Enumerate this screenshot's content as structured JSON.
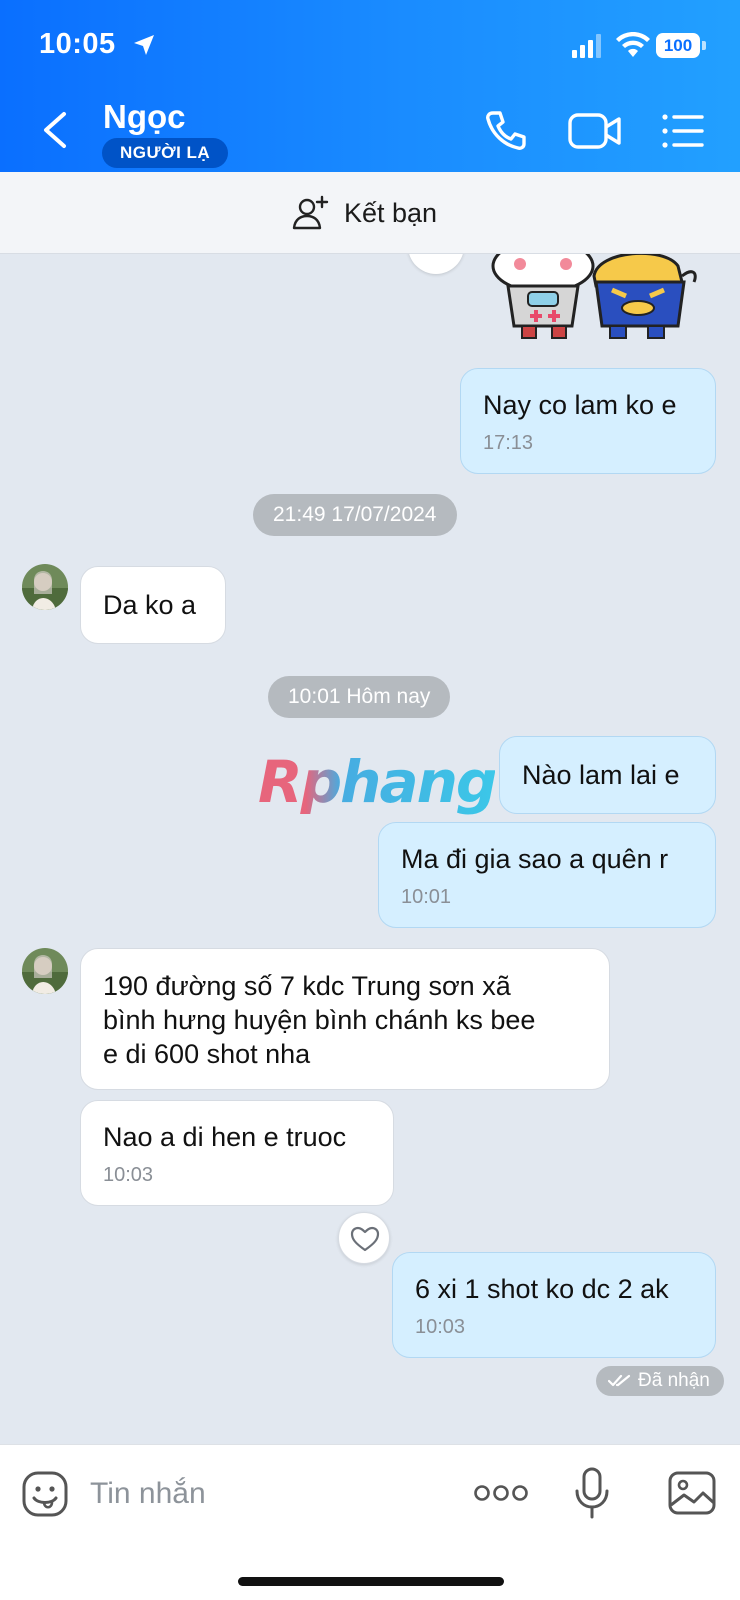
{
  "status_bar": {
    "time": "10:05",
    "battery": "100"
  },
  "header": {
    "contact_name": "Ngọc",
    "badge": "NGƯỜI LẠ"
  },
  "add_friend": {
    "label": "Kết bạn"
  },
  "messages": [
    {
      "side": "out",
      "text": "Nay co lam ko e",
      "time": "17:13"
    },
    {
      "type": "date",
      "text": "21:49 17/07/2024"
    },
    {
      "side": "in",
      "text": "Da ko a"
    },
    {
      "type": "date",
      "text": "10:01 Hôm nay"
    },
    {
      "side": "out",
      "text": "Nào lam lai e"
    },
    {
      "side": "out",
      "text": "Ma đi gia sao a quên r",
      "time": "10:01"
    },
    {
      "side": "in",
      "lines": [
        "190 đường số 7 kdc Trung sơn xã",
        "bình hưng huyện bình chánh ks bee",
        "e di 600 shot nha"
      ]
    },
    {
      "side": "in",
      "text": "Nao a di hen e truoc",
      "time": "10:03"
    },
    {
      "side": "out",
      "text": "6 xi 1 shot ko dc 2 ak",
      "time": "10:03"
    }
  ],
  "received_status": "Đã nhận",
  "watermark": "Rphang",
  "composer": {
    "placeholder": "Tin nhắn"
  },
  "colors": {
    "header_blue": "#0a6fff",
    "bubble_out": "#d5efff",
    "bubble_in": "#ffffff",
    "chat_bg": "#e2e8f0"
  },
  "icons": [
    "location-arrow-icon",
    "signal-icon",
    "wifi-icon",
    "battery-icon",
    "back-icon",
    "phone-icon",
    "video-call-icon",
    "list-menu-icon",
    "add-friend-icon",
    "heart-icon",
    "double-check-icon",
    "emoji-icon",
    "more-icon",
    "mic-icon",
    "gallery-icon"
  ]
}
